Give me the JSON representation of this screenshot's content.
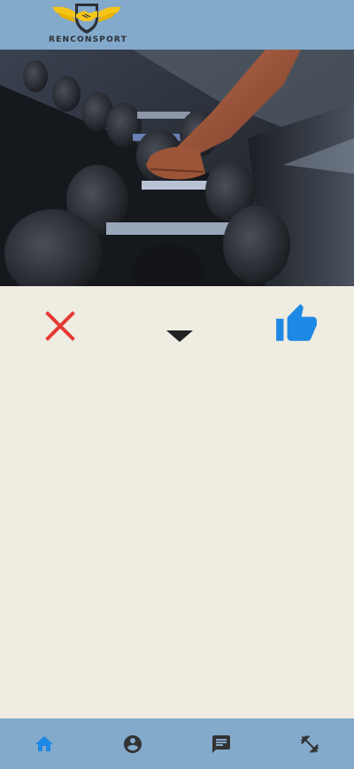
{
  "header": {
    "logo_text": "RENCONSPORT",
    "logo_icon": "handshake-wings-shield-logo"
  },
  "hero": {
    "image": "gym-dumbbell-rack-photo"
  },
  "actions": {
    "reject_icon": "close-icon",
    "expand_icon": "caret-down-icon",
    "like_icon": "thumbs-up-icon"
  },
  "bottom_nav": {
    "items": [
      {
        "icon": "home-icon",
        "active": true
      },
      {
        "icon": "account-circle-icon",
        "active": false
      },
      {
        "icon": "chat-icon",
        "active": false
      },
      {
        "icon": "fitness-icon",
        "active": false
      }
    ]
  },
  "colors": {
    "header_bg": "#83a9cb",
    "page_bg": "#efece1",
    "reject": "#e53935",
    "like": "#1e88e5",
    "nav_active": "#1e88e5",
    "nav_inactive": "#333333",
    "logo_gold": "#f5c518",
    "logo_dark": "#2b2f36"
  }
}
